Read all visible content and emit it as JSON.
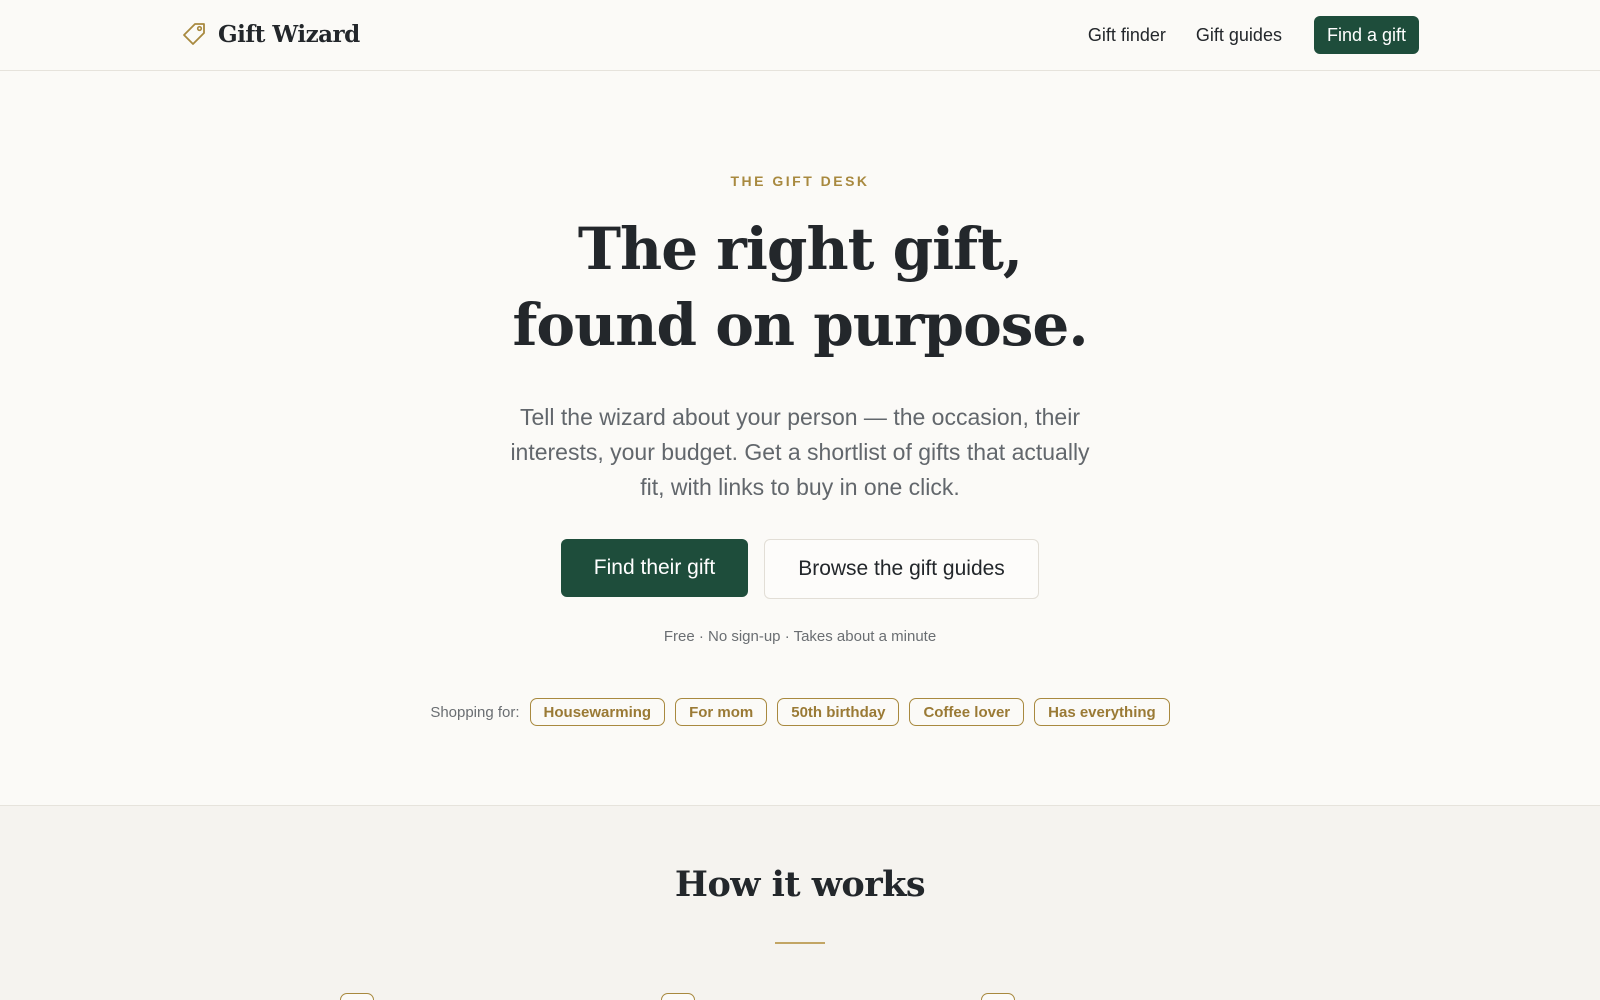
{
  "header": {
    "brand_name": "Gift Wizard",
    "brand_icon": "tag-icon",
    "nav": {
      "gift_finder": "Gift finder",
      "gift_guides": "Gift guides",
      "cta": "Find a gift"
    }
  },
  "hero": {
    "eyebrow": "THE GIFT DESK",
    "headline_line1": "The right gift,",
    "headline_line2": "found on purpose.",
    "subtext": "Tell the wizard about your person — the occasion, their interests, your budget. Get a shortlist of gifts that actually fit, with links to buy in one click.",
    "primary_cta": "Find their gift",
    "secondary_cta": "Browse the gift guides",
    "fine_print": "Free · No sign-up · Takes about a minute",
    "shopping_for_label": "Shopping for:",
    "chips": [
      "Housewarming",
      "For mom",
      "50th birthday",
      "Coffee lover",
      "Has everything"
    ]
  },
  "how_it_works": {
    "title": "How it works"
  },
  "colors": {
    "accent_green": "#1e4d3b",
    "accent_gold": "#a8893f",
    "background": "#fbfaf7"
  }
}
